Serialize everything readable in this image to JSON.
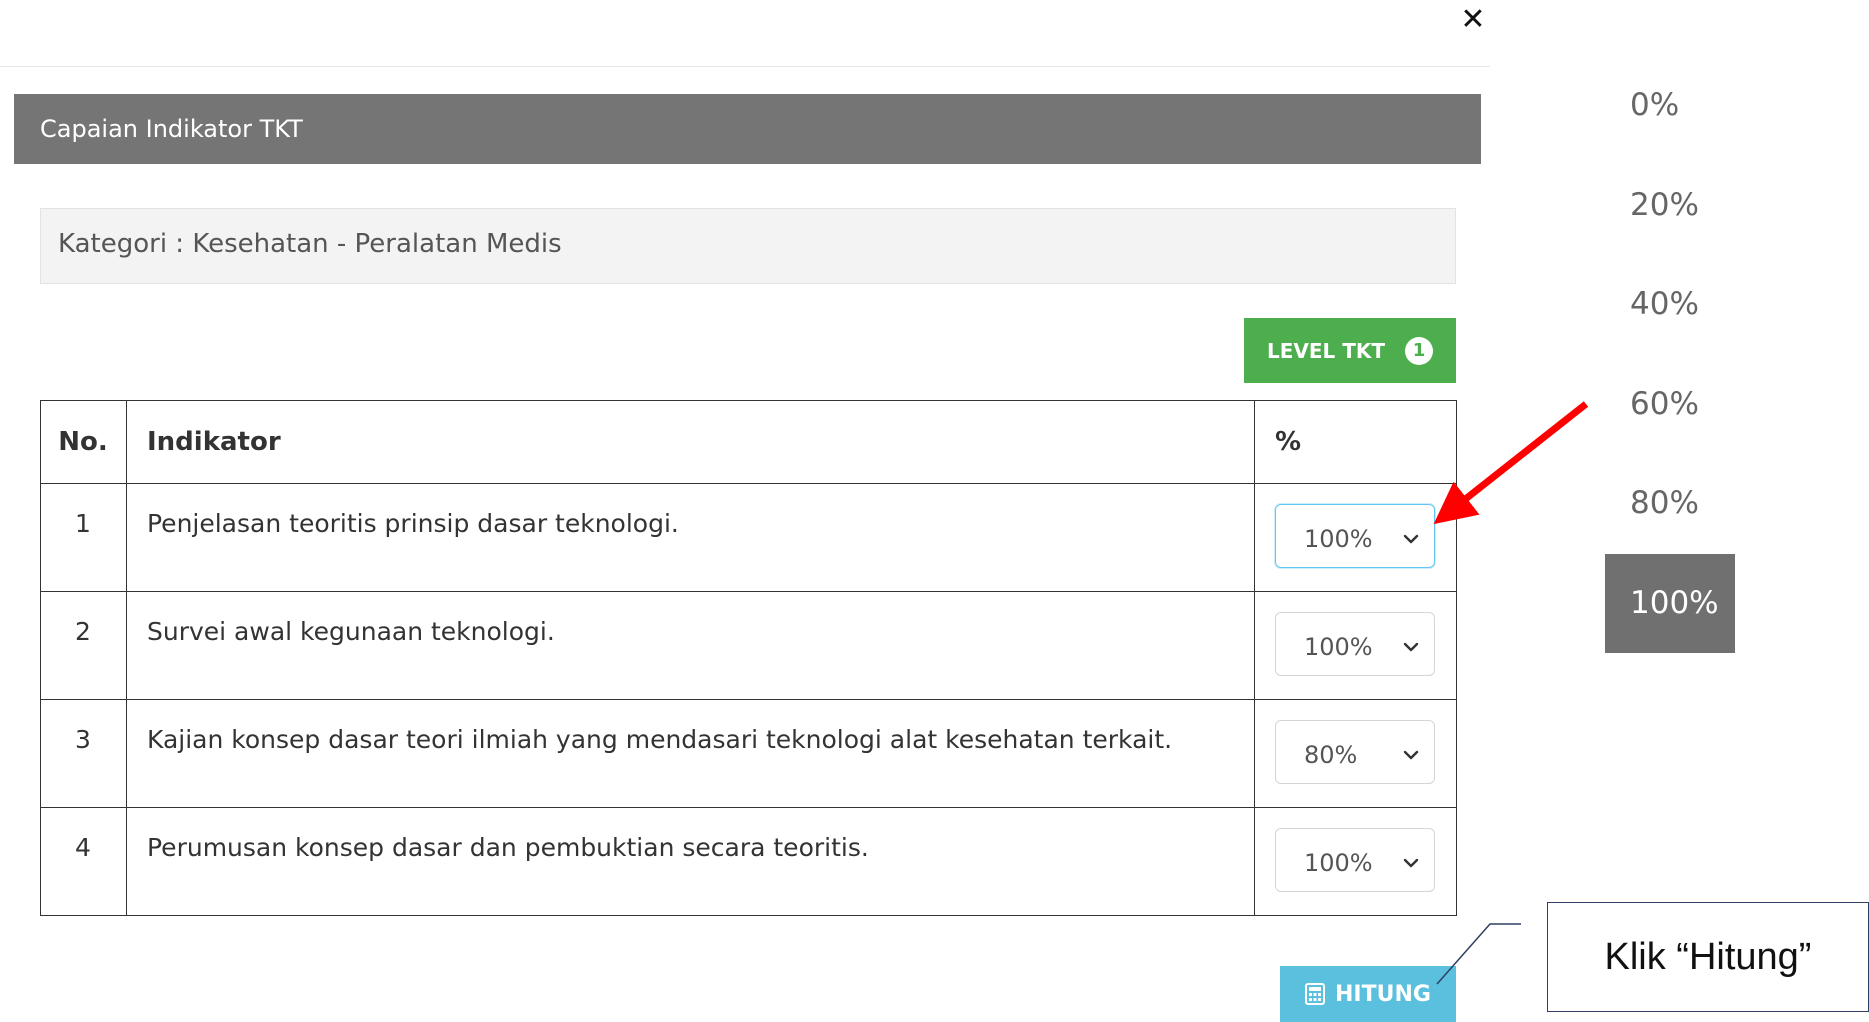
{
  "modal": {
    "close_icon": "close-icon",
    "close_glyph": "✕"
  },
  "panel": {
    "title": "Capaian Indikator TKT"
  },
  "kategori": {
    "text": "Kategori : Kesehatan - Peralatan Medis"
  },
  "level_button": {
    "label": "LEVEL TKT",
    "level": "1",
    "color": "#4cae4c"
  },
  "table": {
    "headers": {
      "no": "No.",
      "indikator": "Indikator",
      "percent": "%"
    },
    "rows": [
      {
        "no": "1",
        "indikator": "Penjelasan teoritis prinsip dasar teknologi.",
        "percent": "100%"
      },
      {
        "no": "2",
        "indikator": "Survei awal kegunaan teknologi.",
        "percent": "100%"
      },
      {
        "no": "3",
        "indikator": "Kajian konsep dasar teori ilmiah yang mendasari teknologi alat kesehatan terkait.",
        "percent": "80%"
      },
      {
        "no": "4",
        "indikator": "Perumusan konsep dasar dan pembuktian secara teoritis.",
        "percent": "100%"
      }
    ]
  },
  "hitung_button": {
    "label": "HITUNG",
    "icon": "calculator-icon",
    "color": "#5bc0de"
  },
  "dropdown_options": [
    "0%",
    "20%",
    "40%",
    "60%",
    "80%",
    "100%"
  ],
  "dropdown_selected": "100%",
  "callout": {
    "text": "Klik “Hitung”"
  },
  "annotation_arrow_color": "#ff0000"
}
